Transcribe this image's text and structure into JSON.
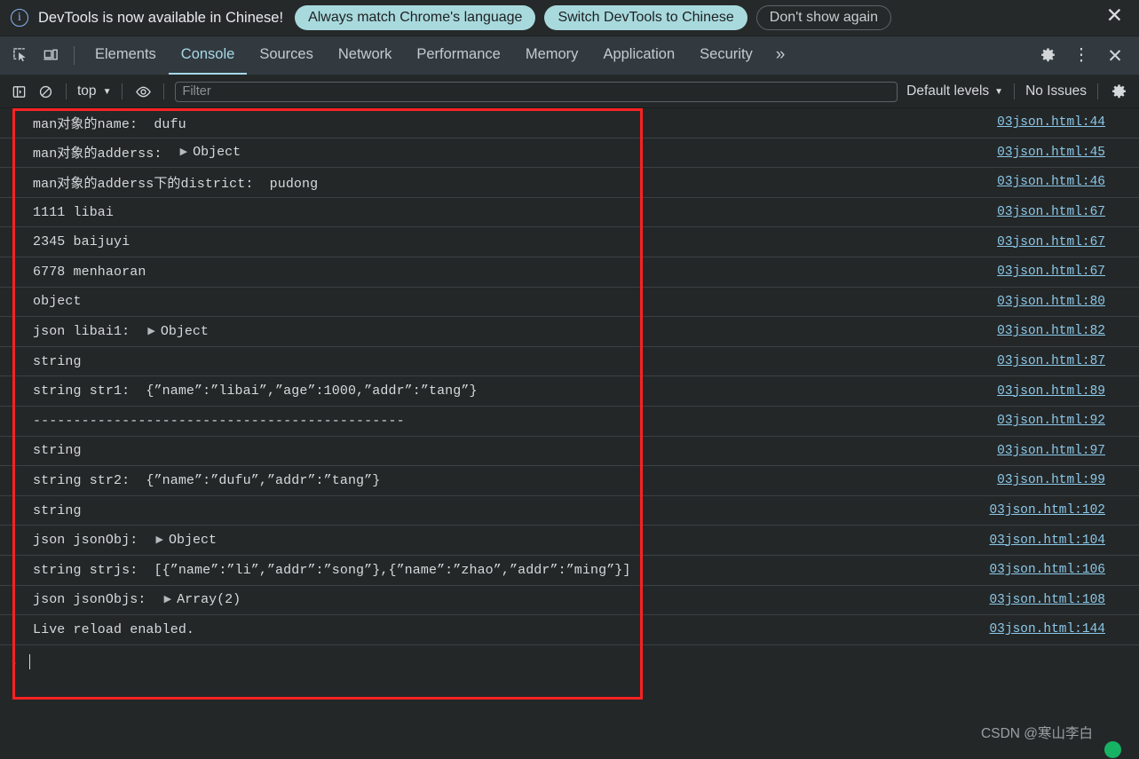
{
  "banner": {
    "icon": "info-circle-icon",
    "message": "DevTools is now available in Chinese!",
    "primary_button": "Always match Chrome's language",
    "secondary_button": "Switch DevTools to Chinese",
    "dismiss_button": "Don't show again",
    "close_icon": "close-icon",
    "accent_color": "#a8dadd"
  },
  "tabbar": {
    "inspect_icon": "inspect-element-icon",
    "device_icon": "device-toolbar-icon",
    "tabs": [
      {
        "label": "Elements",
        "active": false
      },
      {
        "label": "Console",
        "active": true
      },
      {
        "label": "Sources",
        "active": false
      },
      {
        "label": "Network",
        "active": false
      },
      {
        "label": "Performance",
        "active": false
      },
      {
        "label": "Memory",
        "active": false
      },
      {
        "label": "Application",
        "active": false
      },
      {
        "label": "Security",
        "active": false
      }
    ],
    "more_tabs": "»",
    "settings_icon": "gear-icon",
    "kebab_icon": "more-options-icon",
    "close_icon": "close-devtools-icon",
    "active_color": "#a6d8e8"
  },
  "console_toolbar": {
    "sidebar_icon": "show-console-sidebar-icon",
    "clear_icon": "clear-console-icon",
    "context": "top",
    "context_caret": "▼",
    "eye_icon": "live-expression-icon",
    "filter_placeholder": "Filter",
    "filter_value": "",
    "levels_label": "Default levels",
    "levels_caret": "▼",
    "issues_label": "No Issues",
    "settings_icon": "console-settings-icon"
  },
  "console": {
    "rows": [
      {
        "text": "man对象的name:  dufu",
        "expandable": false,
        "source": "03json.html:44"
      },
      {
        "text": "man对象的adderss:  ",
        "expandable": true,
        "object": "Object",
        "source": "03json.html:45"
      },
      {
        "text": "man对象的adderss下的district:  pudong",
        "expandable": false,
        "source": "03json.html:46"
      },
      {
        "text": "1111 libai",
        "expandable": false,
        "source": "03json.html:67"
      },
      {
        "text": "2345 baijuyi",
        "expandable": false,
        "source": "03json.html:67"
      },
      {
        "text": "6778 menhaoran",
        "expandable": false,
        "source": "03json.html:67"
      },
      {
        "text": "object",
        "expandable": false,
        "source": "03json.html:80"
      },
      {
        "text": "json libai1:  ",
        "expandable": true,
        "object": "Object",
        "source": "03json.html:82"
      },
      {
        "text": "string",
        "expandable": false,
        "source": "03json.html:87"
      },
      {
        "text": "string str1:  {”name”:”libai”,”age”:1000,”addr”:”tang”}",
        "expandable": false,
        "source": "03json.html:89"
      },
      {
        "text": "----------------------------------------------",
        "expandable": false,
        "source": "03json.html:92"
      },
      {
        "text": "string",
        "expandable": false,
        "source": "03json.html:97"
      },
      {
        "text": "string str2:  {”name”:”dufu”,”addr”:”tang”}",
        "expandable": false,
        "source": "03json.html:99"
      },
      {
        "text": "string",
        "expandable": false,
        "source": "03json.html:102"
      },
      {
        "text": "json jsonObj:  ",
        "expandable": true,
        "object": "Object",
        "source": "03json.html:104"
      },
      {
        "text": "string strjs:  [{”name”:”li”,”addr”:”song”},{”name”:”zhao”,”addr”:”ming”}]",
        "expandable": false,
        "source": "03json.html:106"
      },
      {
        "text": "json jsonObjs:  ",
        "expandable": true,
        "object": "Array(2)",
        "source": "03json.html:108"
      },
      {
        "text": "Live reload enabled.",
        "expandable": false,
        "source": "03json.html:144"
      }
    ],
    "prompt_arrow": "›",
    "prompt_value": "",
    "highlight_color": "#fa2222"
  },
  "footer": {
    "watermark": "CSDN @寒山李白",
    "dot_color": "#16b364"
  }
}
